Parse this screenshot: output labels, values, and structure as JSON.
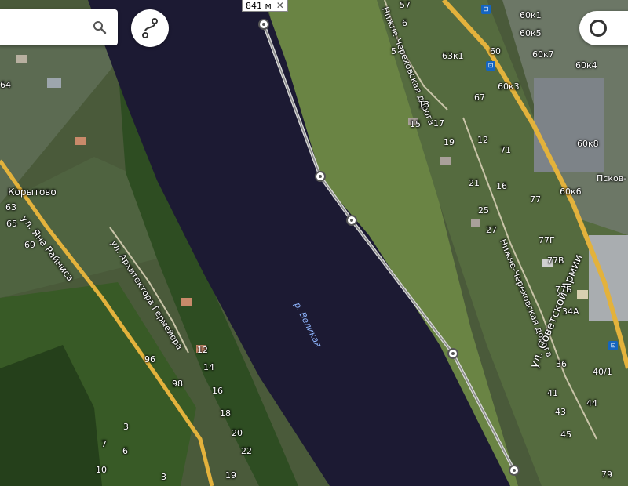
{
  "ruler": {
    "distance": "841 м"
  },
  "river": {
    "name": "р. Великая"
  },
  "streets": [
    {
      "name": "ул. Яна Райниса"
    },
    {
      "name": "ул. Архитектора Гермейера"
    },
    {
      "name": "Нижне-Череховская дорога"
    },
    {
      "name": "Нижне-Череховская дорога"
    },
    {
      "name": "ул. Советской Армии"
    }
  ],
  "places": [
    {
      "name": "Корытово"
    },
    {
      "name": "Псков-"
    }
  ],
  "house_numbers_left": [
    "64",
    "63",
    "65",
    "69",
    "96",
    "98",
    "12",
    "14",
    "16",
    "18",
    "20",
    "22",
    "19",
    "3",
    "6",
    "7",
    "10",
    "3"
  ],
  "house_numbers_right": [
    "57",
    "6",
    "5",
    "63к1",
    "60",
    "60к1",
    "60к5",
    "60к7",
    "60к4",
    "60к3",
    "67",
    "13",
    "15",
    "17",
    "19",
    "12",
    "71",
    "21",
    "16",
    "25",
    "27",
    "77",
    "60к6",
    "60к8",
    "77Г",
    "77В",
    "77Б",
    "34А",
    "36",
    "40/1",
    "41",
    "43",
    "44",
    "45",
    "79"
  ],
  "icons": {
    "search": "search-icon",
    "route": "route-icon",
    "layers": "layers-icon",
    "close": "close-icon",
    "bus_stop": "bus-stop-icon"
  },
  "colors": {
    "river": "#1c1a33",
    "road": "#e3b23c",
    "route_line": "#d9d9d9",
    "vegetation": "#3f6a2a",
    "meadow": "#6f8a45"
  }
}
